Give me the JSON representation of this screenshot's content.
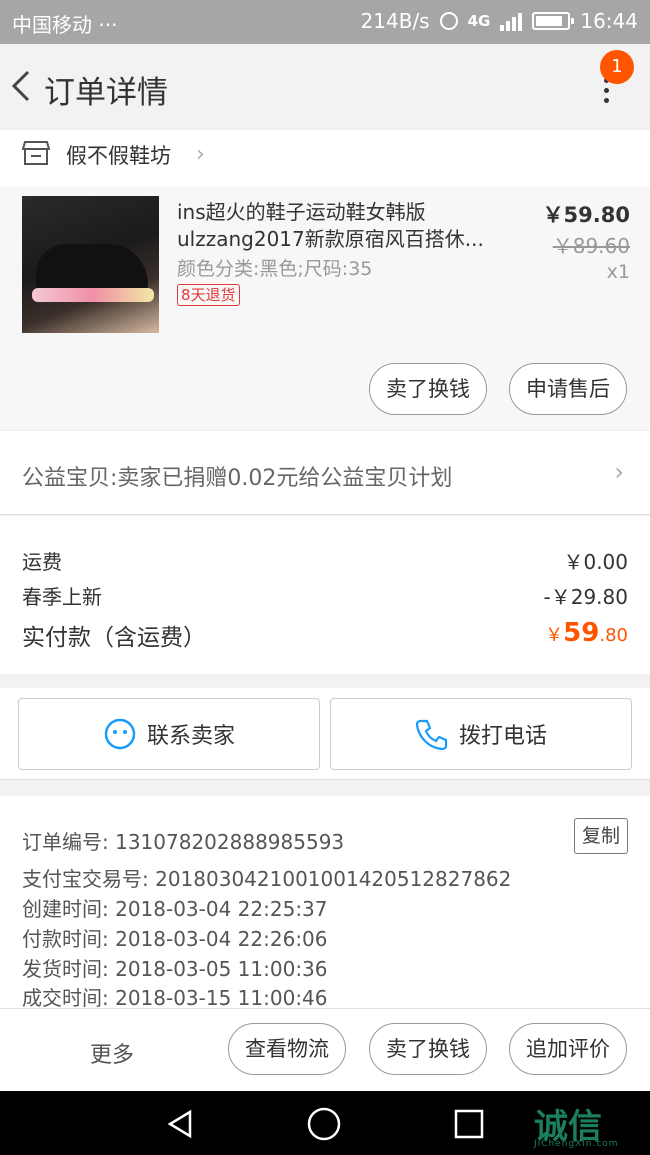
{
  "status_bar": {
    "carrier": "中国移动 ···",
    "speed": "214B/s",
    "network": "4G",
    "network2": "4G",
    "time": "16:44"
  },
  "header": {
    "title": "订单详情",
    "badge_count": "1"
  },
  "shop": {
    "name": "假不假鞋坊"
  },
  "product": {
    "name_line1": "ins超火的鞋子运动鞋女韩版",
    "name_line2": "ulzzang2017新款原宿风百搭休...",
    "spec": "颜色分类:黑色;尺码:35",
    "tag": "8天退货",
    "price": "￥59.80",
    "original_price": "￥89.60",
    "quantity": "x1",
    "btn_sell": "卖了换钱",
    "btn_aftersale": "申请售后"
  },
  "charity": {
    "text": "公益宝贝:卖家已捐赠0.02元给公益宝贝计划"
  },
  "fees": {
    "shipping_label": "运费",
    "shipping_value": "￥0.00",
    "promo_label": "春季上新",
    "promo_value": "-￥29.80",
    "total_label": "实付款（含运费）",
    "total_symbol": "￥",
    "total_int": "59",
    "total_dec": ".80"
  },
  "contact": {
    "seller": "联系卖家",
    "call": "拨打电话"
  },
  "order_info": {
    "order_no": "订单编号: 131078202888985593",
    "alipay_no": "支付宝交易号: 2018030421001001420512827862",
    "created": "创建时间: 2018-03-04 22:25:37",
    "paid": "付款时间: 2018-03-04 22:26:06",
    "shipped": "发货时间: 2018-03-05 11:00:36",
    "completed": "成交时间: 2018-03-15 11:00:46",
    "copy": "复制"
  },
  "bottom_bar": {
    "more": "更多",
    "logistics": "查看物流",
    "sell": "卖了换钱",
    "review": "追加评价"
  },
  "watermark": {
    "text": "诚信",
    "sub": "JiChengXin.com"
  },
  "colors": {
    "accent": "#ff5500",
    "tag_red": "#e4393c",
    "icon_blue": "#1a9bfc"
  }
}
